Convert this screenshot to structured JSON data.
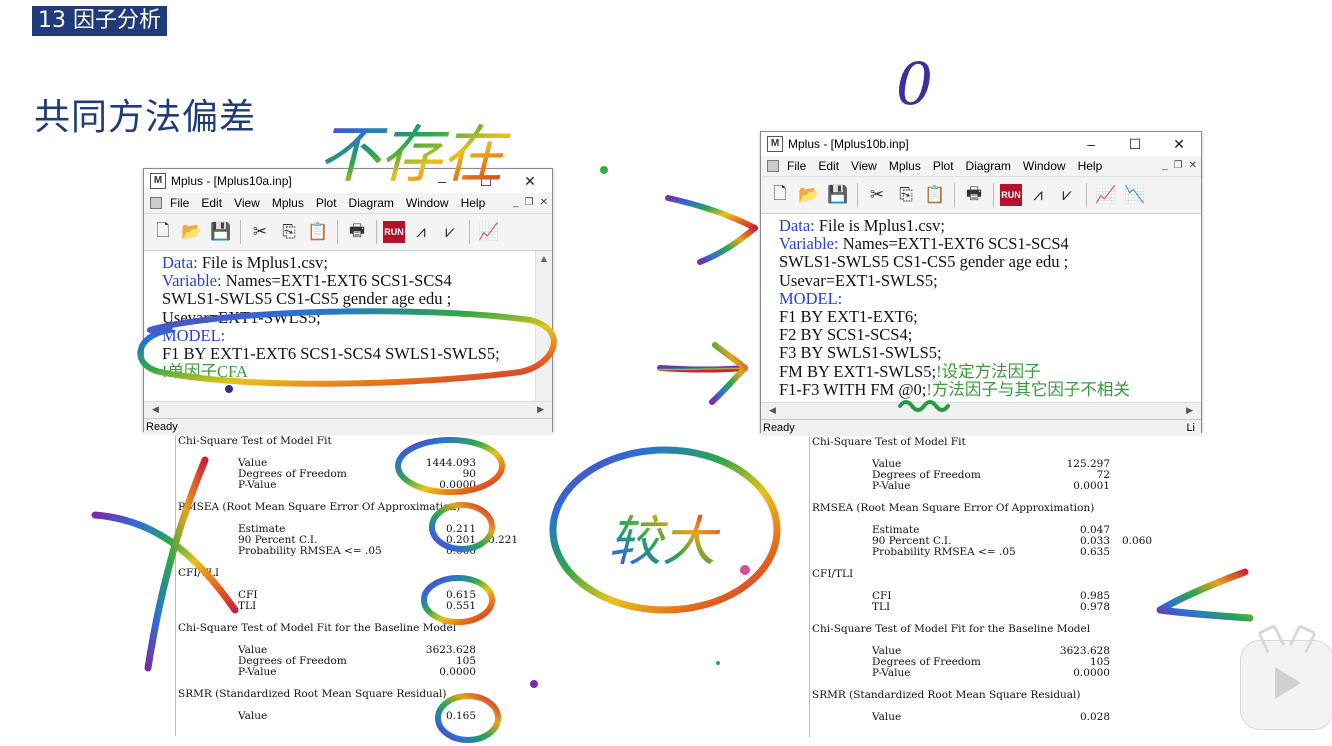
{
  "slide": {
    "section_badge": "13 因子分析",
    "title": "共同方法偏差"
  },
  "colors": {
    "badge_bg": "#1f3b7a",
    "title": "#1f3b7a",
    "keyword": "#2a3fd6",
    "comment": "#3a9a3a",
    "run_button": "#b3122a"
  },
  "left_window": {
    "title": "Mplus - [Mplus10a.inp]",
    "menus": [
      "File",
      "Edit",
      "View",
      "Mplus",
      "Plot",
      "Diagram",
      "Window",
      "Help"
    ],
    "code_lines": [
      {
        "kw": "Data:",
        "text": " File is Mplus1.csv;"
      },
      {
        "kw": "Variable:",
        "text": " Names=EXT1-EXT6 SCS1-SCS4"
      },
      {
        "kw": "",
        "text": "SWLS1-SWLS5 CS1-CS5 gender age edu ;"
      },
      {
        "kw": "",
        "text": "Usevar=EXT1-SWLS5;"
      },
      {
        "kw": "MODEL:",
        "text": ""
      },
      {
        "kw": "",
        "text": "F1 BY EXT1-EXT6 SCS1-SCS4 SWLS1-SWLS5;"
      },
      {
        "kw": "",
        "text": "",
        "comment": "!单因子CFA"
      }
    ],
    "status": "Ready"
  },
  "right_window": {
    "title": "Mplus - [Mplus10b.inp]",
    "menus": [
      "File",
      "Edit",
      "View",
      "Mplus",
      "Plot",
      "Diagram",
      "Window",
      "Help"
    ],
    "code_lines": [
      {
        "kw": "Data:",
        "text": " File is Mplus1.csv;"
      },
      {
        "kw": "Variable:",
        "text": " Names=EXT1-EXT6 SCS1-SCS4"
      },
      {
        "kw": "",
        "text": "SWLS1-SWLS5 CS1-CS5 gender age edu ;"
      },
      {
        "kw": "",
        "text": "Usevar=EXT1-SWLS5;"
      },
      {
        "kw": "MODEL:",
        "text": ""
      },
      {
        "kw": "",
        "text": "F1 BY EXT1-EXT6;"
      },
      {
        "kw": "",
        "text": "F2 BY SCS1-SCS4;"
      },
      {
        "kw": "",
        "text": "F3 BY SWLS1-SWLS5;"
      },
      {
        "kw": "",
        "text": "FM BY EXT1-SWLS5;",
        "comment": "!设定方法因子"
      },
      {
        "kw": "",
        "text": "F1-F3 WITH FM @0;",
        "comment": "!方法因子与其它因子不相关"
      }
    ],
    "status": "Ready",
    "status_right": "Li"
  },
  "left_output": [
    {
      "t": "hdr",
      "text": "Chi-Square Test of Model Fit"
    },
    {
      "t": "blank"
    },
    {
      "t": "row",
      "label": "Value",
      "v1": "1444.093"
    },
    {
      "t": "row",
      "label": "Degrees of Freedom",
      "v1": "90"
    },
    {
      "t": "row",
      "label": "P-Value",
      "v1": "0.0000"
    },
    {
      "t": "blank"
    },
    {
      "t": "hdr",
      "text": "RMSEA (Root Mean Square Error Of Approximation)"
    },
    {
      "t": "blank"
    },
    {
      "t": "row",
      "label": "Estimate",
      "v1": "0.211"
    },
    {
      "t": "row",
      "label": "90 Percent C.I.",
      "v1": "0.201",
      "v2": "0.221"
    },
    {
      "t": "row",
      "label": "Probability RMSEA <= .05",
      "v1": "0.000"
    },
    {
      "t": "blank"
    },
    {
      "t": "hdr",
      "text": "CFI/TLI"
    },
    {
      "t": "blank"
    },
    {
      "t": "row",
      "label": "CFI",
      "v1": "0.615"
    },
    {
      "t": "row",
      "label": "TLI",
      "v1": "0.551"
    },
    {
      "t": "blank"
    },
    {
      "t": "hdr",
      "text": "Chi-Square Test of Model Fit for the Baseline Model"
    },
    {
      "t": "blank"
    },
    {
      "t": "row",
      "label": "Value",
      "v1": "3623.628"
    },
    {
      "t": "row",
      "label": "Degrees of Freedom",
      "v1": "105"
    },
    {
      "t": "row",
      "label": "P-Value",
      "v1": "0.0000"
    },
    {
      "t": "blank"
    },
    {
      "t": "hdr",
      "text": "SRMR (Standardized Root Mean Square Residual)"
    },
    {
      "t": "blank"
    },
    {
      "t": "row",
      "label": "Value",
      "v1": "0.165"
    }
  ],
  "right_output": [
    {
      "t": "hdr",
      "text": "Chi-Square Test of Model Fit"
    },
    {
      "t": "blank"
    },
    {
      "t": "row",
      "label": "Value",
      "v1": "125.297"
    },
    {
      "t": "row",
      "label": "Degrees of Freedom",
      "v1": "72"
    },
    {
      "t": "row",
      "label": "P-Value",
      "v1": "0.0001"
    },
    {
      "t": "blank"
    },
    {
      "t": "hdr",
      "text": "RMSEA (Root Mean Square Error Of Approximation)"
    },
    {
      "t": "blank"
    },
    {
      "t": "row",
      "label": "Estimate",
      "v1": "0.047"
    },
    {
      "t": "row",
      "label": "90 Percent C.I.",
      "v1": "0.033",
      "v2": "0.060"
    },
    {
      "t": "row",
      "label": "Probability RMSEA <= .05",
      "v1": "0.635"
    },
    {
      "t": "blank"
    },
    {
      "t": "hdr",
      "text": "CFI/TLI"
    },
    {
      "t": "blank"
    },
    {
      "t": "row",
      "label": "CFI",
      "v1": "0.985"
    },
    {
      "t": "row",
      "label": "TLI",
      "v1": "0.978"
    },
    {
      "t": "blank"
    },
    {
      "t": "hdr",
      "text": "Chi-Square Test of Model Fit for the Baseline Model"
    },
    {
      "t": "blank"
    },
    {
      "t": "row",
      "label": "Value",
      "v1": "3623.628"
    },
    {
      "t": "row",
      "label": "Degrees of Freedom",
      "v1": "105"
    },
    {
      "t": "row",
      "label": "P-Value",
      "v1": "0.0000"
    },
    {
      "t": "blank"
    },
    {
      "t": "hdr",
      "text": "SRMR (Standardized Root Mean Square Residual)"
    },
    {
      "t": "blank"
    },
    {
      "t": "row",
      "label": "Value",
      "v1": "0.028"
    }
  ],
  "annotations": {
    "handwritten_top": "不存在",
    "handwritten_mid": "较大",
    "handwritten_zero": "0"
  }
}
